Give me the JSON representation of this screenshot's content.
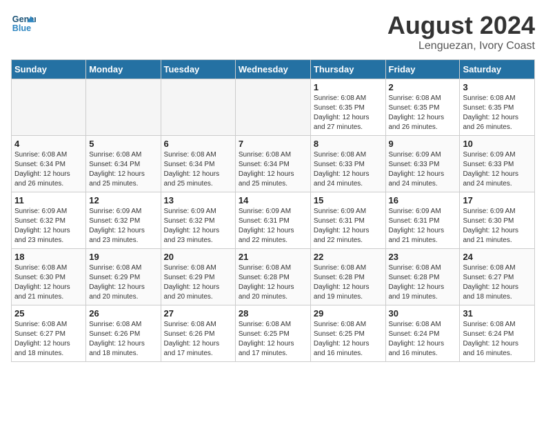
{
  "header": {
    "logo_line1": "General",
    "logo_line2": "Blue",
    "month_year": "August 2024",
    "location": "Lenguezan, Ivory Coast"
  },
  "weekdays": [
    "Sunday",
    "Monday",
    "Tuesday",
    "Wednesday",
    "Thursday",
    "Friday",
    "Saturday"
  ],
  "weeks": [
    [
      {
        "day": "",
        "empty": true
      },
      {
        "day": "",
        "empty": true
      },
      {
        "day": "",
        "empty": true
      },
      {
        "day": "",
        "empty": true
      },
      {
        "day": "1",
        "sunrise": "6:08 AM",
        "sunset": "6:35 PM",
        "daylight": "12 hours and 27 minutes."
      },
      {
        "day": "2",
        "sunrise": "6:08 AM",
        "sunset": "6:35 PM",
        "daylight": "12 hours and 26 minutes."
      },
      {
        "day": "3",
        "sunrise": "6:08 AM",
        "sunset": "6:35 PM",
        "daylight": "12 hours and 26 minutes."
      }
    ],
    [
      {
        "day": "4",
        "sunrise": "6:08 AM",
        "sunset": "6:34 PM",
        "daylight": "12 hours and 26 minutes."
      },
      {
        "day": "5",
        "sunrise": "6:08 AM",
        "sunset": "6:34 PM",
        "daylight": "12 hours and 25 minutes."
      },
      {
        "day": "6",
        "sunrise": "6:08 AM",
        "sunset": "6:34 PM",
        "daylight": "12 hours and 25 minutes."
      },
      {
        "day": "7",
        "sunrise": "6:08 AM",
        "sunset": "6:34 PM",
        "daylight": "12 hours and 25 minutes."
      },
      {
        "day": "8",
        "sunrise": "6:08 AM",
        "sunset": "6:33 PM",
        "daylight": "12 hours and 24 minutes."
      },
      {
        "day": "9",
        "sunrise": "6:09 AM",
        "sunset": "6:33 PM",
        "daylight": "12 hours and 24 minutes."
      },
      {
        "day": "10",
        "sunrise": "6:09 AM",
        "sunset": "6:33 PM",
        "daylight": "12 hours and 24 minutes."
      }
    ],
    [
      {
        "day": "11",
        "sunrise": "6:09 AM",
        "sunset": "6:32 PM",
        "daylight": "12 hours and 23 minutes."
      },
      {
        "day": "12",
        "sunrise": "6:09 AM",
        "sunset": "6:32 PM",
        "daylight": "12 hours and 23 minutes."
      },
      {
        "day": "13",
        "sunrise": "6:09 AM",
        "sunset": "6:32 PM",
        "daylight": "12 hours and 23 minutes."
      },
      {
        "day": "14",
        "sunrise": "6:09 AM",
        "sunset": "6:31 PM",
        "daylight": "12 hours and 22 minutes."
      },
      {
        "day": "15",
        "sunrise": "6:09 AM",
        "sunset": "6:31 PM",
        "daylight": "12 hours and 22 minutes."
      },
      {
        "day": "16",
        "sunrise": "6:09 AM",
        "sunset": "6:31 PM",
        "daylight": "12 hours and 21 minutes."
      },
      {
        "day": "17",
        "sunrise": "6:09 AM",
        "sunset": "6:30 PM",
        "daylight": "12 hours and 21 minutes."
      }
    ],
    [
      {
        "day": "18",
        "sunrise": "6:08 AM",
        "sunset": "6:30 PM",
        "daylight": "12 hours and 21 minutes."
      },
      {
        "day": "19",
        "sunrise": "6:08 AM",
        "sunset": "6:29 PM",
        "daylight": "12 hours and 20 minutes."
      },
      {
        "day": "20",
        "sunrise": "6:08 AM",
        "sunset": "6:29 PM",
        "daylight": "12 hours and 20 minutes."
      },
      {
        "day": "21",
        "sunrise": "6:08 AM",
        "sunset": "6:28 PM",
        "daylight": "12 hours and 20 minutes."
      },
      {
        "day": "22",
        "sunrise": "6:08 AM",
        "sunset": "6:28 PM",
        "daylight": "12 hours and 19 minutes."
      },
      {
        "day": "23",
        "sunrise": "6:08 AM",
        "sunset": "6:28 PM",
        "daylight": "12 hours and 19 minutes."
      },
      {
        "day": "24",
        "sunrise": "6:08 AM",
        "sunset": "6:27 PM",
        "daylight": "12 hours and 18 minutes."
      }
    ],
    [
      {
        "day": "25",
        "sunrise": "6:08 AM",
        "sunset": "6:27 PM",
        "daylight": "12 hours and 18 minutes."
      },
      {
        "day": "26",
        "sunrise": "6:08 AM",
        "sunset": "6:26 PM",
        "daylight": "12 hours and 18 minutes."
      },
      {
        "day": "27",
        "sunrise": "6:08 AM",
        "sunset": "6:26 PM",
        "daylight": "12 hours and 17 minutes."
      },
      {
        "day": "28",
        "sunrise": "6:08 AM",
        "sunset": "6:25 PM",
        "daylight": "12 hours and 17 minutes."
      },
      {
        "day": "29",
        "sunrise": "6:08 AM",
        "sunset": "6:25 PM",
        "daylight": "12 hours and 16 minutes."
      },
      {
        "day": "30",
        "sunrise": "6:08 AM",
        "sunset": "6:24 PM",
        "daylight": "12 hours and 16 minutes."
      },
      {
        "day": "31",
        "sunrise": "6:08 AM",
        "sunset": "6:24 PM",
        "daylight": "12 hours and 16 minutes."
      }
    ]
  ],
  "labels": {
    "sunrise": "Sunrise:",
    "sunset": "Sunset:",
    "daylight": "Daylight:"
  }
}
